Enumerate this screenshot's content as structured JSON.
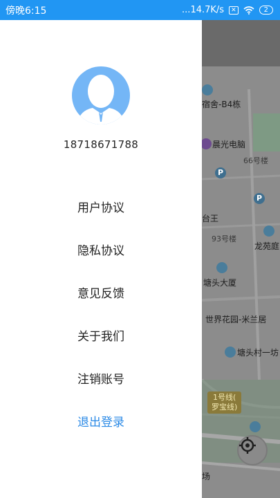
{
  "status_bar": {
    "time": "傍晚6:15",
    "network_speed": "...14.7K/s",
    "sim_icon": "sim-x-icon",
    "wifi_icon": "wifi-icon",
    "battery": "2"
  },
  "user": {
    "phone": "18718671788"
  },
  "menu": {
    "items": [
      {
        "label": "用户协议"
      },
      {
        "label": "隐私协议"
      },
      {
        "label": "意见反馈"
      },
      {
        "label": "关于我们"
      },
      {
        "label": "注销账号"
      }
    ],
    "logout_label": "退出登录"
  },
  "map": {
    "labels": {
      "l1": "宿舍-B4栋",
      "l2": "晨光电脑",
      "l3": "66号楼",
      "l4": "台王",
      "l5": "93号楼",
      "l6": "龙苑庭",
      "l7": "塘头大厦",
      "l8": "世界花园-米兰居",
      "l9": "塘头村一坊",
      "l10": "场"
    },
    "metro_line": "1号线(",
    "metro_name": "罗宝线)"
  },
  "colors": {
    "status_bar": "#2196f3",
    "accent": "#2b8ae6",
    "avatar": "#74b6f6"
  }
}
